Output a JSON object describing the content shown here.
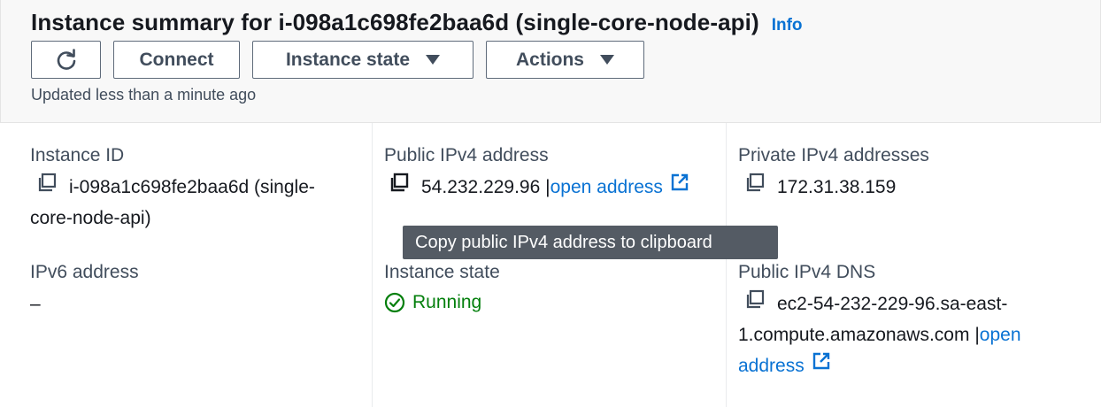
{
  "header": {
    "title": "Instance summary for i-098a1c698fe2baa6d (single-core-node-api)",
    "info_label": "Info",
    "buttons": {
      "refresh_icon": "refresh-icon",
      "connect": "Connect",
      "instance_state": "Instance state",
      "actions": "Actions"
    },
    "updated": "Updated less than a minute ago"
  },
  "details": {
    "instance_id": {
      "label": "Instance ID",
      "value_line1": "i-098a1c698fe2baa6d (single-",
      "value_line2": "core-node-api)"
    },
    "public_ipv4": {
      "label": "Public IPv4 address",
      "value": "54.232.229.96",
      "separator": "|",
      "link": "open address"
    },
    "private_ipv4": {
      "label": "Private IPv4 addresses",
      "value": "172.31.38.159"
    },
    "ipv6": {
      "label": "IPv6 address",
      "value": "–"
    },
    "instance_state": {
      "label": "Instance state",
      "value": "Running"
    },
    "public_dns": {
      "label": "Public IPv4 DNS",
      "value_line1": "ec2-54-232-229-96.sa-east-",
      "value_line2": "1.compute.amazonaws.com",
      "separator": "|",
      "link_line1": "open",
      "link_line2": "address"
    }
  },
  "tooltip": "Copy public IPv4 address to clipboard",
  "colors": {
    "link": "#0972d3",
    "success": "#037f0c",
    "tooltip_bg": "#545b64"
  }
}
